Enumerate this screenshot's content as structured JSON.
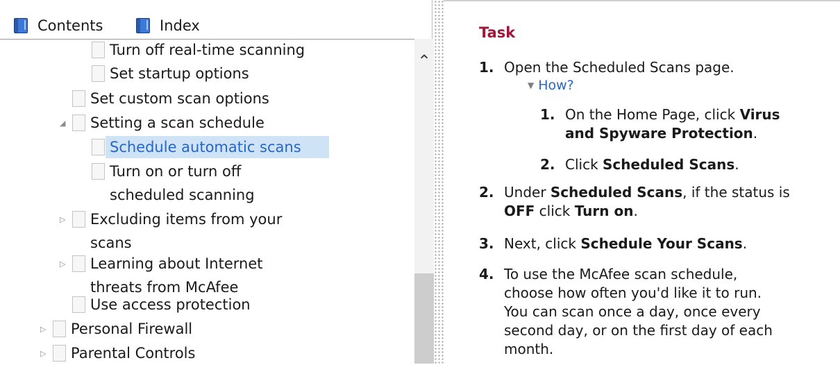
{
  "tabs": {
    "contents": "Contents",
    "index": "Index"
  },
  "tree": {
    "items": [
      {
        "label": "Turn off real-time scanning"
      },
      {
        "label": "Set startup options"
      },
      {
        "label": "Set custom scan options"
      },
      {
        "label": "Setting a scan schedule"
      },
      {
        "label": "Schedule automatic scans"
      },
      {
        "label": "Turn on or turn off",
        "label2": "scheduled scanning"
      },
      {
        "label": "Excluding items from your",
        "label2": "scans"
      },
      {
        "label": "Learning about Internet",
        "label2": "threats from McAfee"
      },
      {
        "label": "Use access protection"
      },
      {
        "label": "Personal Firewall"
      },
      {
        "label": "Parental Controls"
      }
    ]
  },
  "task": {
    "heading": "Task",
    "steps": [
      {
        "num": "1.",
        "parts": [
          "Open the Scheduled Scans page."
        ]
      },
      {
        "num": "2.",
        "l1_pre": "Under ",
        "l1_b1": "Scheduled Scans",
        "l1_post": ", if the status is",
        "l2_b1": "OFF",
        "l2_mid": " click ",
        "l2_b2": "Turn on",
        "l2_post": "."
      },
      {
        "num": "3.",
        "pre": "Next, click ",
        "b": "Schedule Your Scans",
        "post": "."
      },
      {
        "num": "4.",
        "lines": [
          "To use the McAfee scan schedule,",
          "choose how often you'd like it to run.",
          "You can scan once a day, once every",
          "second day, or on the first day of each",
          "month."
        ]
      }
    ],
    "how_label": "How?",
    "substeps": [
      {
        "num": "1.",
        "l1_pre": "On the Home Page, click ",
        "l1_b": "Virus",
        "l2_b": "and Spyware Protection",
        "l2_post": "."
      },
      {
        "num": "2.",
        "pre": "Click ",
        "b": "Scheduled Scans",
        "post": "."
      }
    ]
  }
}
